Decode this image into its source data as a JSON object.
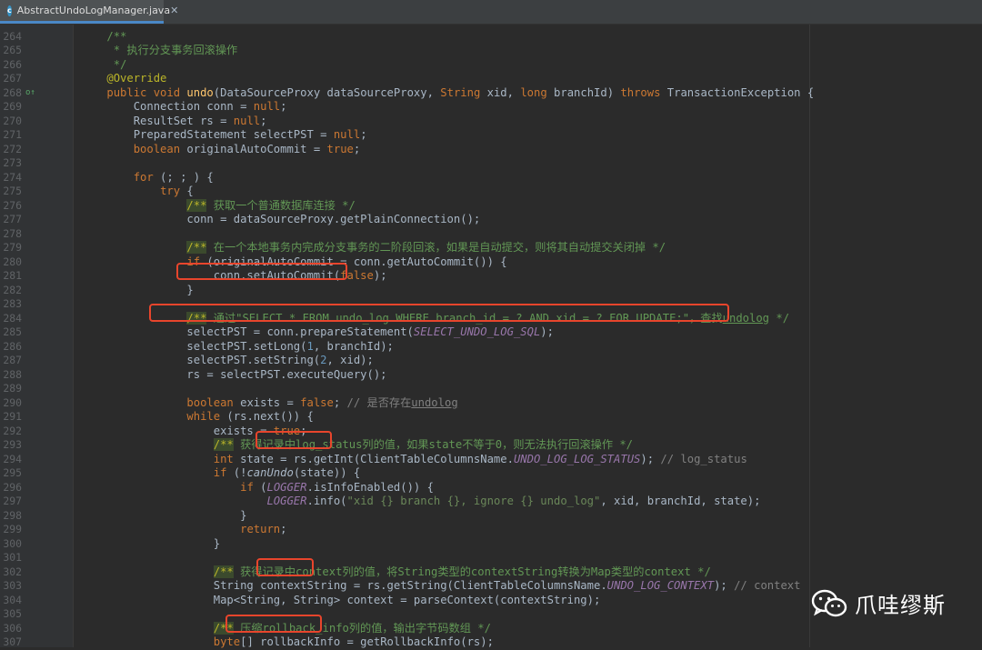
{
  "tab": {
    "title": "AbstractUndoLogManager.java"
  },
  "editor": {
    "lines": [
      {
        "num": "264",
        "html": "    <span class='doc'>/**</span>"
      },
      {
        "num": "265",
        "html": "     <span class='doc'>* 执行分支事务回滚操作</span>"
      },
      {
        "num": "266",
        "html": "     <span class='doc'>*/</span>"
      },
      {
        "num": "267",
        "html": "    <span class='an'>@Override</span>"
      },
      {
        "num": "268",
        "marker": "o↑",
        "html": "    <span class='kw'>public void </span><span class='fn'>undo</span>(DataSourceProxy dataSourceProxy, <span class='kw'>String</span> xid, <span class='kw'>long</span> branchId) <span class='kw'>throws</span> TransactionException {"
      },
      {
        "num": "269",
        "html": "        Connection conn = <span class='kw'>null</span>;"
      },
      {
        "num": "270",
        "html": "        ResultSet rs = <span class='kw'>null</span>;"
      },
      {
        "num": "271",
        "html": "        PreparedStatement selectPST = <span class='kw'>null</span>;"
      },
      {
        "num": "272",
        "html": "        <span class='kw'>boolean</span> originalAutoCommit = <span class='kw'>true</span>;"
      },
      {
        "num": "273",
        "html": ""
      },
      {
        "num": "274",
        "html": "        <span class='kw'>for</span> (; ; ) {"
      },
      {
        "num": "275",
        "html": "            <span class='kw'>try</span> {"
      },
      {
        "num": "276",
        "html": "                <span class='hl'>/**</span><span class='doc'> 获取一个普通数据库连接 */</span>"
      },
      {
        "num": "277",
        "html": "                conn = dataSourceProxy.getPlainConnection();"
      },
      {
        "num": "278",
        "html": ""
      },
      {
        "num": "279",
        "html": "                <span class='hl'>/**</span><span class='doc'> 在一个本地事务内完成分支事务的二阶段回滚，如果是自动提交，则将其自动提交关闭掉 */</span>"
      },
      {
        "num": "280",
        "html": "                <span class='kw'>if</span> (originalAutoCommit = conn.getAutoCommit()) {"
      },
      {
        "num": "281",
        "html": "                    conn.setAutoCommit(<span class='kw'>false</span>);"
      },
      {
        "num": "282",
        "html": "                }"
      },
      {
        "num": "283",
        "html": ""
      },
      {
        "num": "284",
        "html": "                <span class='hl'>/**</span><span class='doc'> 通过\"SELECT * FROM undo_log WHERE branch_id = ? AND xid = ? FOR UPDATE;\"，查找<span class='ul'>undolog</span> */</span>"
      },
      {
        "num": "285",
        "html": "                selectPST = conn.prepareStatement(<span class='field it'>SELECT_UNDO_LOG_SQL</span>);"
      },
      {
        "num": "286",
        "html": "                selectPST.setLong(<span class='num'>1</span>, branchId);"
      },
      {
        "num": "287",
        "html": "                selectPST.setString(<span class='num'>2</span>, xid);"
      },
      {
        "num": "288",
        "html": "                rs = selectPST.executeQuery();"
      },
      {
        "num": "289",
        "html": ""
      },
      {
        "num": "290",
        "html": "                <span class='kw'>boolean</span> exists = <span class='kw'>false</span>; <span class='cm'>// 是否存在<span class='ul'>undolog</span></span>"
      },
      {
        "num": "291",
        "html": "                <span class='kw'>while</span> (rs.next()) {"
      },
      {
        "num": "292",
        "html": "                    exists = <span class='kw'>true</span>;"
      },
      {
        "num": "293",
        "html": "                    <span class='hl'>/**</span><span class='doc'> 获得记录中log_status列的值，如果state不等于0，则无法执行回滚操作 */</span>"
      },
      {
        "num": "294",
        "html": "                    <span class='kw'>int</span> state = rs.getInt(ClientTableColumnsName.<span class='field it'>UNDO_LOG_LOG_STATUS</span>); <span class='cm'>// log_status</span>"
      },
      {
        "num": "295",
        "html": "                    <span class='kw'>if</span> (!<span class='it'>canUndo</span>(state)) {"
      },
      {
        "num": "296",
        "html": "                        <span class='kw'>if</span> (<span class='field it'>LOGGER</span>.isInfoEnabled()) {"
      },
      {
        "num": "297",
        "html": "                            <span class='field it'>LOGGER</span>.info(<span class='str'>\"xid {} branch {}, ignore {} undo_log\"</span>, xid, branchId, state);"
      },
      {
        "num": "298",
        "html": "                        }"
      },
      {
        "num": "299",
        "html": "                        <span class='kw'>return</span>;"
      },
      {
        "num": "300",
        "html": "                    }"
      },
      {
        "num": "301",
        "html": ""
      },
      {
        "num": "302",
        "html": "                    <span class='hl'>/**</span><span class='doc'> 获得记录中context列的值，将String类型的contextString转换为Map类型的context */</span>"
      },
      {
        "num": "303",
        "html": "                    String contextString = rs.getString(ClientTableColumnsName.<span class='field it'>UNDO_LOG_CONTEXT</span>); <span class='cm'>// context</span>"
      },
      {
        "num": "304",
        "html": "                    Map&lt;String, String&gt; context = parseContext(contextString);"
      },
      {
        "num": "305",
        "html": ""
      },
      {
        "num": "306",
        "html": "                    <span class='hl'>/**</span><span class='doc'> 压缩rollback_info列的值，输出字节码数组 */</span>"
      },
      {
        "num": "307",
        "html": "                    <span class='kw'>byte</span>[] rollbackInfo = getRollbackInfo(rs);"
      }
    ]
  },
  "watermark": {
    "text": "爪哇缪斯"
  }
}
